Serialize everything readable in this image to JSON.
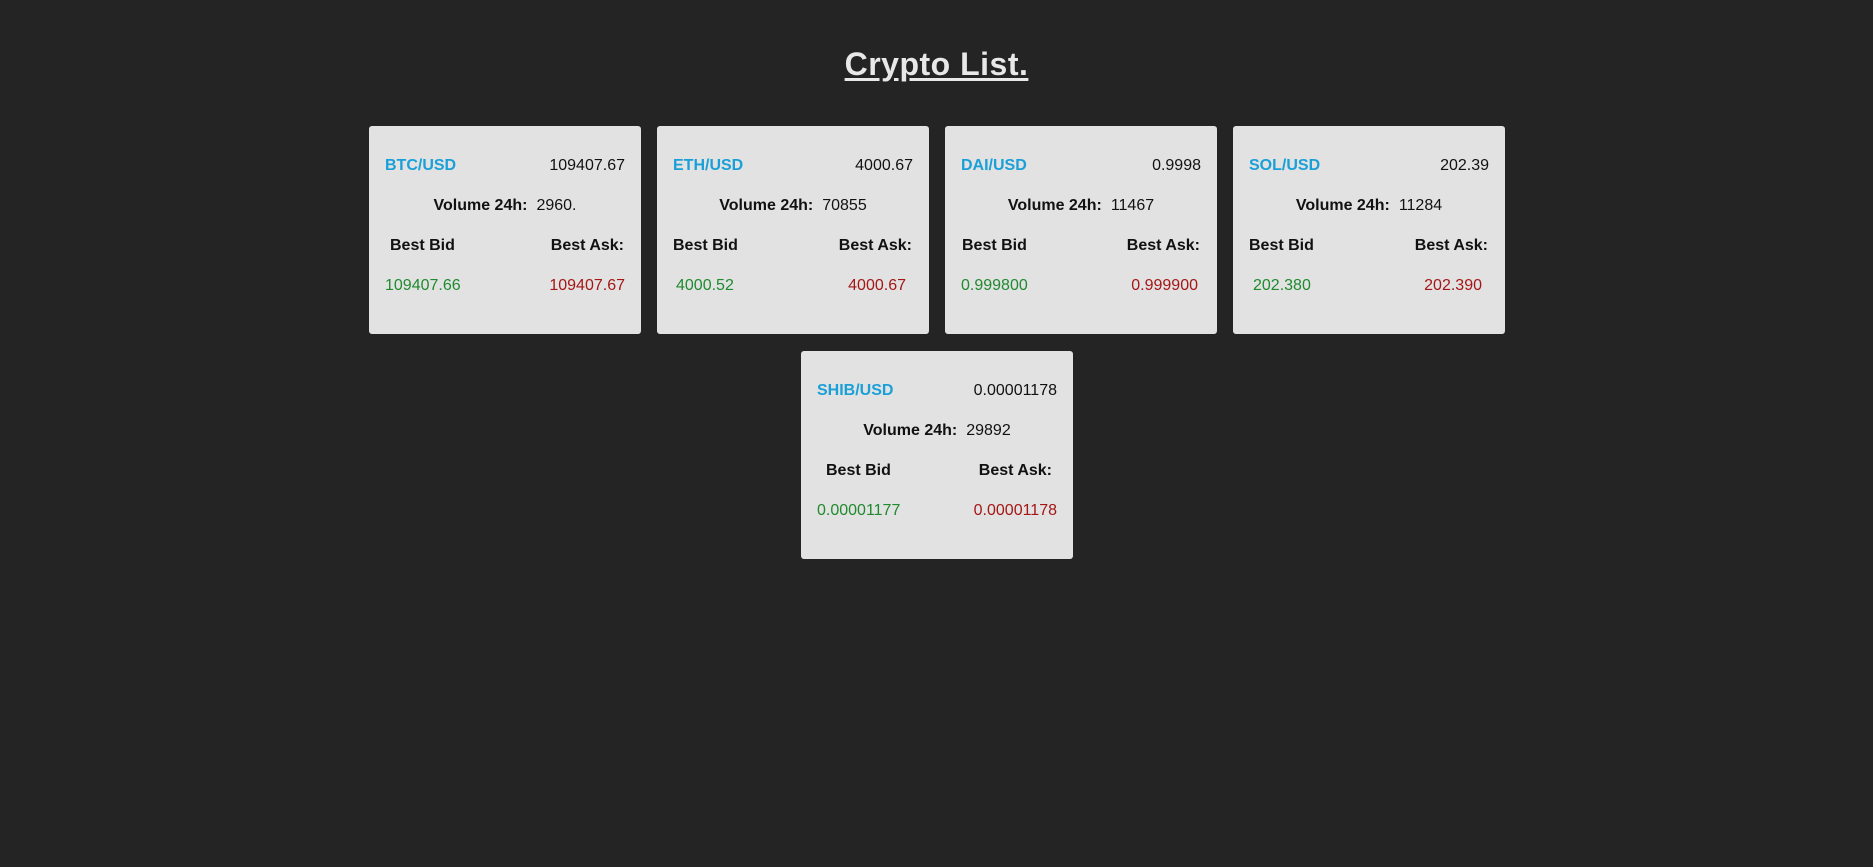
{
  "page": {
    "title": "Crypto List."
  },
  "labels": {
    "volume": "Volume 24h:",
    "best_bid": "Best Bid",
    "best_ask": "Best Ask:"
  },
  "cards": [
    {
      "pair": "BTC/USD",
      "price": "109407.67",
      "volume": "2960.",
      "bid": "109407.66",
      "ask": "109407.67"
    },
    {
      "pair": "ETH/USD",
      "price": "4000.67",
      "volume": "70855",
      "bid": "4000.52",
      "ask": "4000.67"
    },
    {
      "pair": "DAI/USD",
      "price": "0.9998",
      "volume": "11467",
      "bid": "0.999800",
      "ask": "0.999900"
    },
    {
      "pair": "SOL/USD",
      "price": "202.39",
      "volume": "11284",
      "bid": "202.380",
      "ask": "202.390"
    },
    {
      "pair": "SHIB/USD",
      "price": "0.00001178",
      "volume": "29892",
      "bid": "0.00001177",
      "ask": "0.00001178"
    }
  ],
  "colors": {
    "background": "#242424",
    "card": "#e2e2e2",
    "pair": "#1aa0d8",
    "bid": "#1f8a2e",
    "ask": "#a51616"
  }
}
